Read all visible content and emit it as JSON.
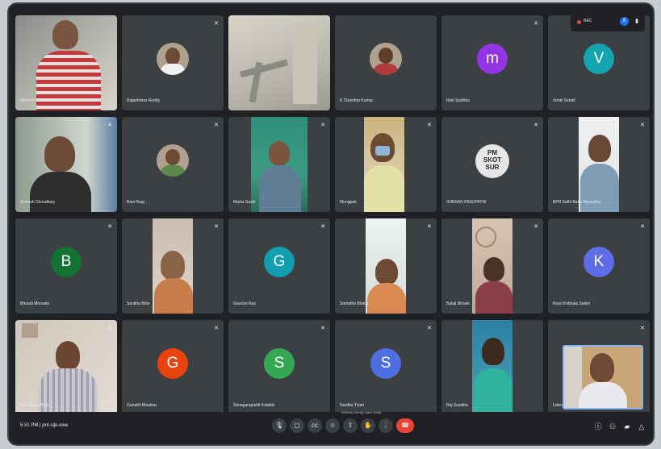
{
  "recording": {
    "label": "REC",
    "people_badge": "9"
  },
  "tiles": [
    {
      "name": "Minnesh Basheesh",
      "type": "video"
    },
    {
      "name": "Rajashekar Reddy",
      "type": "photo"
    },
    {
      "name": "",
      "type": "video"
    },
    {
      "name": "K Chandrip Kumar",
      "type": "photo"
    },
    {
      "name": "Nisli Sashiba",
      "type": "letter",
      "letter": "m",
      "color": "#9334e6"
    },
    {
      "name": "Venki Seball",
      "type": "letter",
      "letter": "V",
      "color": "#12a4af"
    },
    {
      "name": "Guhash Choudhary",
      "type": "video"
    },
    {
      "name": "Ravi Raaj",
      "type": "photo"
    },
    {
      "name": "Marks Sushi",
      "type": "video"
    },
    {
      "name": "Mungpati",
      "type": "video"
    },
    {
      "name": "SHERAN PASUPATHI",
      "type": "text-avatar",
      "avatar_text": "PM\nSKOT\nSUR"
    },
    {
      "name": "BPR Sathi Babu Mazurkha",
      "type": "video"
    },
    {
      "name": "Bhurati Mhosale",
      "type": "letter",
      "letter": "B",
      "color": "#137333"
    },
    {
      "name": "Sunitha Birla",
      "type": "video"
    },
    {
      "name": "Gourisri Rao",
      "type": "letter",
      "letter": "G",
      "color": "#129eaf"
    },
    {
      "name": "Srimathe Bhatia",
      "type": "video"
    },
    {
      "name": "Balaji Bhosle",
      "type": "video"
    },
    {
      "name": "Kiran Koltirala Sailen",
      "type": "letter",
      "letter": "K",
      "color": "#5f6de8"
    },
    {
      "name": "Ravi Madu Babu",
      "type": "video"
    },
    {
      "name": "Gunathi Bhaskar",
      "type": "letter",
      "letter": "G",
      "color": "#e8430f"
    },
    {
      "name": "Srinagarajeshti Kotakki",
      "type": "letter",
      "letter": "S",
      "color": "#34a853"
    },
    {
      "name": "Swetha Tivari",
      "type": "letter",
      "letter": "S",
      "color": "#4f6ee0"
    },
    {
      "name": "Raj Susidha",
      "type": "video"
    },
    {
      "name": "Lokesh",
      "type": "self"
    }
  ],
  "bottom": {
    "time": "5:31 PM",
    "separator": "|",
    "meeting_code": "pnt-sijk-ewe",
    "tooltip": "Nishiray (Venky Liam Joshi)"
  },
  "controls": [
    "mic",
    "camera",
    "captions",
    "emoji",
    "present",
    "raise-hand",
    "more",
    "hang-up"
  ],
  "right_controls": [
    "info",
    "people",
    "chat",
    "activities"
  ]
}
